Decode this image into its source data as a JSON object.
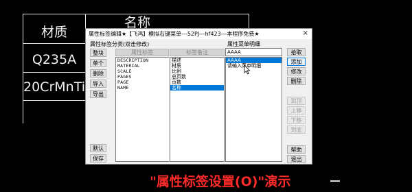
{
  "cad_table": {
    "header_right": "名称",
    "rows": [
      {
        "label": "材质"
      },
      {
        "label": "Q235A"
      },
      {
        "label": "20CrMnTi"
      }
    ]
  },
  "dialog": {
    "title": "属性标签编辑★【飞鸿】模拟右键菜单---52PJ---hf423---本程序免费★",
    "close_glyph": "×",
    "left_group_label": "属性标签分类(双击修改)",
    "right_group_label": "属性菜单明细",
    "left_buttons": [
      {
        "label": "整块"
      },
      {
        "label": "单个"
      },
      {
        "label": "删除"
      },
      {
        "label": "导入"
      },
      {
        "label": "导出"
      },
      {
        "label": "默认"
      },
      {
        "label": "保存"
      }
    ],
    "column_headers": {
      "tag": "属性标签",
      "note": "标签备注"
    },
    "tag_list": [
      "DESCRIPTION",
      "MATERIAL",
      "SCALE",
      "PAGES",
      "PAGE",
      "NAME"
    ],
    "note_list": [
      {
        "text": "描述",
        "selected": false
      },
      {
        "text": "材质",
        "selected": false
      },
      {
        "text": "比例",
        "selected": false
      },
      {
        "text": "总页数",
        "selected": false
      },
      {
        "text": "页数",
        "selected": false
      },
      {
        "text": "名称",
        "selected": true
      }
    ],
    "menu_input_value": "AAAA",
    "menu_list": [
      {
        "text": "AAAA",
        "selected": true
      },
      {
        "text": "请输入菜单明细",
        "selected": false
      }
    ],
    "right_buttons": [
      {
        "label": "拾取",
        "state": "normal"
      },
      {
        "label": "添加",
        "state": "active"
      },
      {
        "label": "修改",
        "state": "normal"
      },
      {
        "label": "删除",
        "state": "normal"
      },
      {
        "label": "到顶",
        "state": "disabled"
      },
      {
        "label": "上移",
        "state": "disabled"
      },
      {
        "label": "下移",
        "state": "disabled"
      },
      {
        "label": "到底",
        "state": "disabled"
      },
      {
        "label": "帮助",
        "state": "normal"
      },
      {
        "label": "退出",
        "state": "normal"
      }
    ]
  },
  "caption": "\"属性标签设置(O)\"演示",
  "colors": {
    "background": "#000000",
    "selection": "#0078d7",
    "caption": "#ff2a2a"
  }
}
